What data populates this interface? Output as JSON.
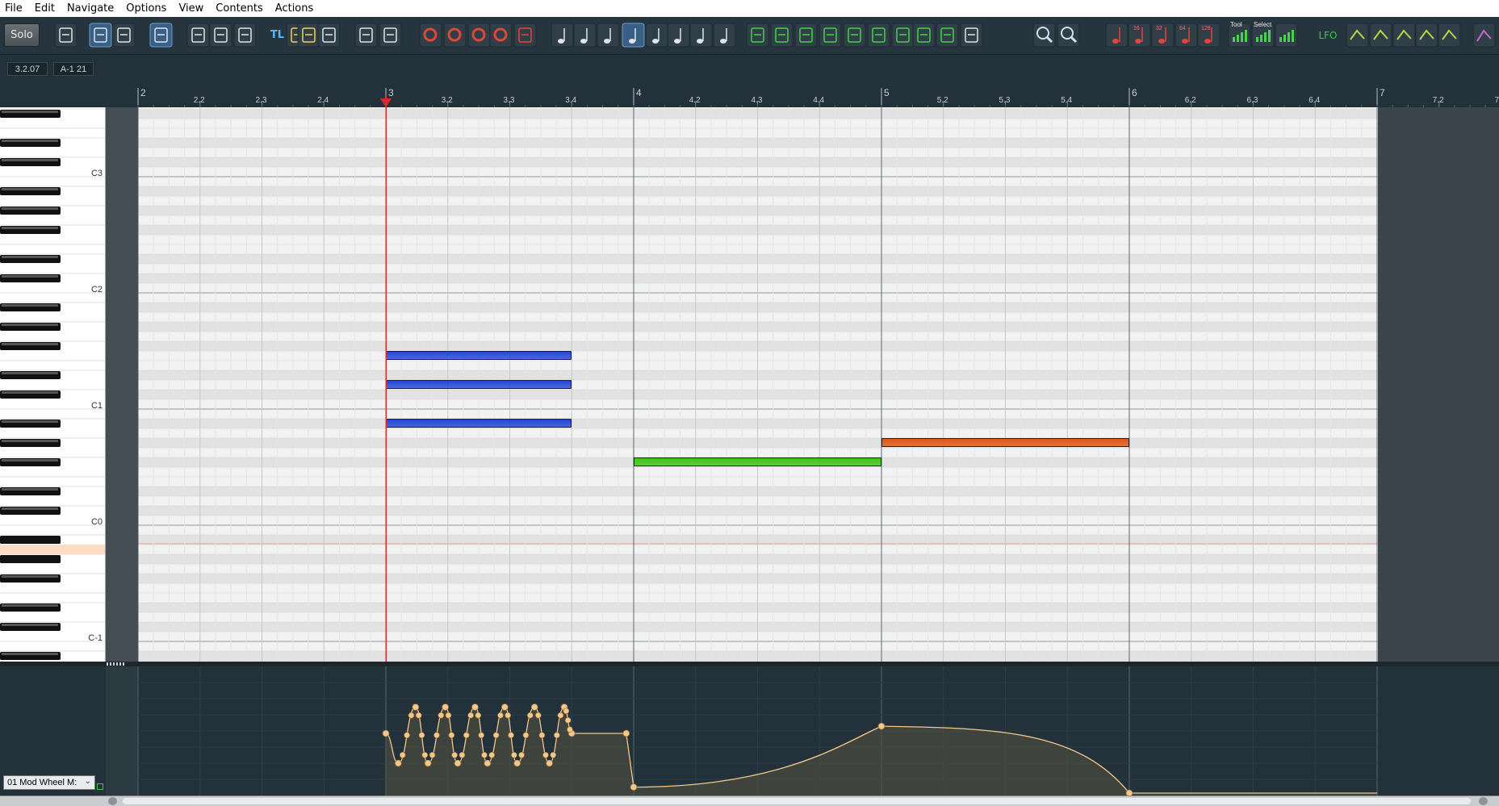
{
  "menu": {
    "items": [
      "File",
      "Edit",
      "Navigate",
      "Options",
      "View",
      "Contents",
      "Actions"
    ]
  },
  "toolbar": {
    "solo_label": "Solo",
    "timeline_label": "TL",
    "lfo_label": "LFO",
    "tool_label": "Tool",
    "select_label": "Select",
    "quantize_labels": [
      "16",
      "32",
      "64",
      "128"
    ],
    "buttons": [
      "piano-view-icon",
      "list-view-icon",
      "notation-view-icon",
      "loop-icon",
      "snap-icon",
      "wash-icon",
      "scrub-icon",
      "timeline-icon",
      "insert-marker-icon",
      "chord-icon",
      "step-back-icon",
      "step-forward-icon",
      "record-icon",
      "overdub-icon",
      "replace-icon",
      "loop-record-icon",
      "metronome-icon",
      "whole-note-icon",
      "half-note-icon",
      "quarter-note-icon",
      "eighth-note-icon",
      "sixteenth-note-icon",
      "thirtysecond-note-icon",
      "dotted-note-icon",
      "triplet-note-icon",
      "quantize-icon",
      "humanize-icon",
      "legato-icon",
      "velocity-icon",
      "transpose-icon",
      "length-icon",
      "scissors-icon",
      "split-icon",
      "glue-icon",
      "pencil-icon",
      "zoom-in-icon",
      "zoom-out-icon"
    ]
  },
  "info": {
    "position": "3.2.07",
    "note": "A-1  21"
  },
  "ruler": {
    "labels": [
      "2",
      "2.2",
      "2.3",
      "2.4",
      "3",
      "3.2",
      "3.3",
      "3.4",
      "4",
      "4.2",
      "4.3",
      "4.4",
      "5",
      "5.2",
      "5.3",
      "5.4",
      "6",
      "6.2",
      "6.3",
      "6.4",
      "7",
      "7.2",
      "7"
    ]
  },
  "piano": {
    "octave_labels": [
      "C3",
      "C2",
      "C1",
      "C0",
      "C-1"
    ],
    "highlighted_key": "A-1"
  },
  "notes": [
    {
      "start_bar": 3.0,
      "end_bar": 3.75,
      "pitch": "F1",
      "color": "#2347d6"
    },
    {
      "start_bar": 3.0,
      "end_bar": 3.75,
      "pitch": "D1",
      "color": "#2347d6"
    },
    {
      "start_bar": 3.0,
      "end_bar": 3.75,
      "pitch": "A#0",
      "color": "#2347d6"
    },
    {
      "start_bar": 4.0,
      "end_bar": 5.0,
      "pitch": "F#0",
      "color": "#3ec414"
    },
    {
      "start_bar": 5.0,
      "end_bar": 6.0,
      "pitch": "G#0",
      "color": "#e05612"
    }
  ],
  "playhead_bar": 3.0,
  "automation": {
    "controller_label": "01 Mod Wheel M:",
    "curve_color": "#f5c88a",
    "points": [
      {
        "bar": 3.0,
        "value": 0.5
      },
      {
        "bar": 3.05,
        "value": 0.25
      },
      {
        "bar": 3.12,
        "value": 0.72
      },
      {
        "bar": 3.17,
        "value": 0.25
      },
      {
        "bar": 3.24,
        "value": 0.72
      },
      {
        "bar": 3.29,
        "value": 0.25
      },
      {
        "bar": 3.36,
        "value": 0.72
      },
      {
        "bar": 3.41,
        "value": 0.25
      },
      {
        "bar": 3.48,
        "value": 0.72
      },
      {
        "bar": 3.53,
        "value": 0.25
      },
      {
        "bar": 3.6,
        "value": 0.72
      },
      {
        "bar": 3.66,
        "value": 0.25
      },
      {
        "bar": 3.72,
        "value": 0.72
      },
      {
        "bar": 3.75,
        "value": 0.5
      },
      {
        "bar": 3.97,
        "value": 0.5
      },
      {
        "bar": 4.0,
        "value": 0.05
      },
      {
        "bar": 5.0,
        "value": 0.56
      },
      {
        "bar": 6.0,
        "value": 0.0
      },
      {
        "bar": 7.0,
        "value": 0.0
      }
    ]
  },
  "colors": {
    "accent": "#3a5f86",
    "playhead": "#d92b2b",
    "grid_bg": "#f2f2f2",
    "grid_dark_row": "#e2e2e2"
  }
}
